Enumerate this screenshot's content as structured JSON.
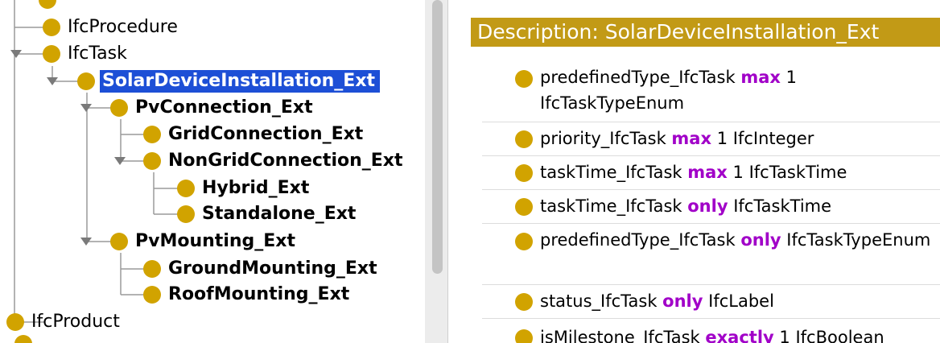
{
  "tree": {
    "nodes": [
      {
        "id": "procedure",
        "label": "IfcProcedure"
      },
      {
        "id": "task",
        "label": "IfcTask"
      },
      {
        "id": "solar",
        "label": "SolarDeviceInstallation_Ext"
      },
      {
        "id": "pvconn",
        "label": "PvConnection_Ext"
      },
      {
        "id": "grid",
        "label": "GridConnection_Ext"
      },
      {
        "id": "nongrid",
        "label": "NonGridConnection_Ext"
      },
      {
        "id": "hybrid",
        "label": "Hybrid_Ext"
      },
      {
        "id": "standalone",
        "label": "Standalone_Ext"
      },
      {
        "id": "pvmount",
        "label": "PvMounting_Ext"
      },
      {
        "id": "ground",
        "label": "GroundMounting_Ext"
      },
      {
        "id": "roof",
        "label": "RoofMounting_Ext"
      },
      {
        "id": "product",
        "label": "IfcProduct"
      }
    ],
    "selected": "SolarDeviceInstallation_Ext"
  },
  "description": {
    "header": "Description: SolarDeviceInstallation_Ext",
    "axioms": [
      {
        "prop": "predefinedType_IfcTask",
        "kw": "max",
        "rest": "1 IfcTaskTypeEnum"
      },
      {
        "prop": "priority_IfcTask",
        "kw": "max",
        "rest": "1 IfcInteger"
      },
      {
        "prop": "taskTime_IfcTask",
        "kw": "max",
        "rest": "1 IfcTaskTime"
      },
      {
        "prop": "taskTime_IfcTask",
        "kw": "only",
        "rest": "IfcTaskTime"
      },
      {
        "prop": "predefinedType_IfcTask",
        "kw": "only",
        "rest": "IfcTaskTypeEnum"
      },
      {
        "prop": "status_IfcTask",
        "kw": "only",
        "rest": "IfcLabel"
      },
      {
        "prop": "isMilestone_IfcTask",
        "kw": "exactly",
        "rest": "1 IfcBoolean"
      }
    ]
  },
  "colors": {
    "class_circle": "#d1a300",
    "selection": "#1d4fd6",
    "header_bg": "#c29a16",
    "keyword": "#a100c8"
  }
}
